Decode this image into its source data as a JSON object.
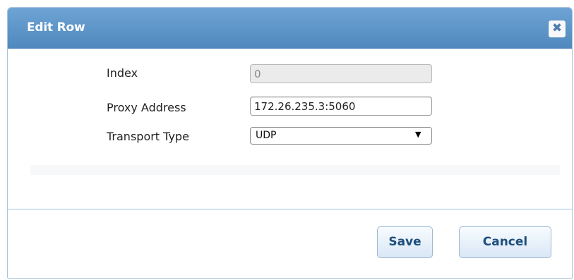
{
  "dialog": {
    "title": "Edit Row",
    "close_icon": "close-icon",
    "close_glyph": "✖"
  },
  "form": {
    "index": {
      "label": "Index",
      "value": "0"
    },
    "proxy_address": {
      "label": "Proxy Address",
      "value": "172.26.235.3:5060"
    },
    "transport_type": {
      "label": "Transport Type",
      "value": "UDP",
      "arrow_glyph": "▼"
    }
  },
  "buttons": {
    "save_label": "Save",
    "cancel_label": "Cancel"
  },
  "colors": {
    "title_bar": "#5b93c8",
    "button_text": "#1f4e7d",
    "divider": "#9cc3e6"
  }
}
